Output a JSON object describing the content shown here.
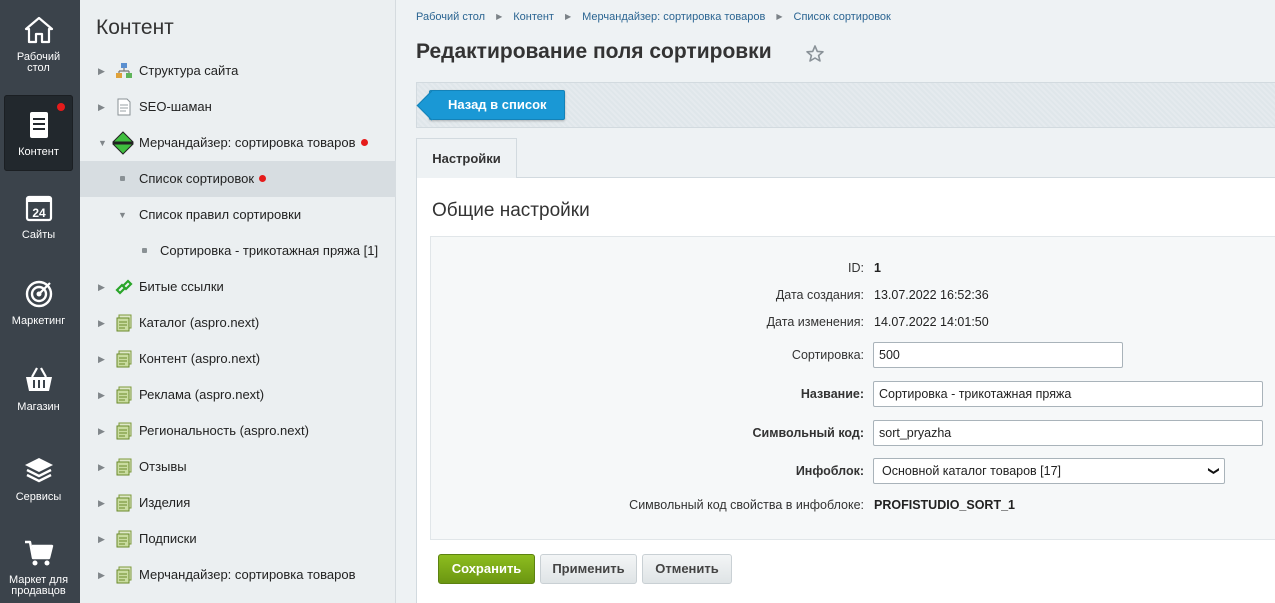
{
  "rail": {
    "items": [
      {
        "label": "Рабочий стол",
        "icon": "home-icon"
      },
      {
        "label": "Контент",
        "icon": "document-icon",
        "active": true,
        "has_alert": true
      },
      {
        "label": "Сайты",
        "icon": "calendar-24-icon"
      },
      {
        "label": "Маркетинг",
        "icon": "target-icon"
      },
      {
        "label": "Магазин",
        "icon": "basket-icon"
      },
      {
        "label": "Сервисы",
        "icon": "layers-icon"
      },
      {
        "label": "Маркет для продавцов",
        "icon": "cart-icon"
      }
    ]
  },
  "tree": {
    "title": "Контент",
    "items": [
      {
        "label": "Структура сайта",
        "icon": "site-structure-icon",
        "arrow": "right"
      },
      {
        "label": "SEO-шаман",
        "icon": "page-icon",
        "arrow": "right"
      },
      {
        "label": "Мерчандайзер: сортировка товаров",
        "icon": "merchandiser-icon",
        "arrow": "down",
        "has_alert": true
      },
      {
        "label": "Список сортировок",
        "bullet": true,
        "selected": true,
        "has_alert": true
      },
      {
        "label": "Список правил сортировки",
        "arrow": "down"
      },
      {
        "label": "Сортировка - трикотажная пряжа [1]",
        "bullet": true
      },
      {
        "label": "Битые ссылки",
        "icon": "broken-link-icon",
        "arrow": "right"
      },
      {
        "label": "Каталог (aspro.next)",
        "icon": "iblock-icon",
        "arrow": "right"
      },
      {
        "label": "Контент (aspro.next)",
        "icon": "iblock-icon",
        "arrow": "right"
      },
      {
        "label": "Реклама (aspro.next)",
        "icon": "iblock-icon",
        "arrow": "right"
      },
      {
        "label": "Региональность (aspro.next)",
        "icon": "iblock-icon",
        "arrow": "right"
      },
      {
        "label": "Отзывы",
        "icon": "iblock-icon",
        "arrow": "right"
      },
      {
        "label": "Изделия",
        "icon": "iblock-icon",
        "arrow": "right"
      },
      {
        "label": "Подписки",
        "icon": "iblock-icon",
        "arrow": "right"
      },
      {
        "label": "Мерчандайзер: сортировка товаров",
        "icon": "iblock-icon",
        "arrow": "right"
      }
    ]
  },
  "breadcrumb": [
    "Рабочий стол",
    "Контент",
    "Мерчандайзер: сортировка товаров",
    "Список сортировок"
  ],
  "page_title": "Редактирование поля сортировки",
  "toolbar": {
    "back_label": "Назад в список"
  },
  "tabs": [
    {
      "label": "Настройки"
    }
  ],
  "section_title": "Общие настройки",
  "form": {
    "id": {
      "label": "ID:",
      "value": "1"
    },
    "created": {
      "label": "Дата создания:",
      "value": "13.07.2022 16:52:36"
    },
    "modified": {
      "label": "Дата изменения:",
      "value": "14.07.2022 14:01:50"
    },
    "sort": {
      "label": "Сортировка:",
      "value": "500"
    },
    "name": {
      "label": "Название:",
      "value": "Сортировка - трикотажная пряжа"
    },
    "code": {
      "label": "Символьный код:",
      "value": "sort_pryazha"
    },
    "iblock": {
      "label": "Инфоблок:",
      "value": "Основной каталог товаров [17]"
    },
    "prop_code": {
      "label": "Символьный код свойства в инфоблоке:",
      "value": "PROFISTUDIO_SORT_1"
    }
  },
  "buttons": {
    "save": "Сохранить",
    "apply": "Применить",
    "cancel": "Отменить"
  },
  "colors": {
    "rail_bg": "#3b434b",
    "accent_blue": "#1a98d5",
    "save_green": "#77a416",
    "alert_red": "#e51b1b",
    "link": "#2b6592"
  }
}
